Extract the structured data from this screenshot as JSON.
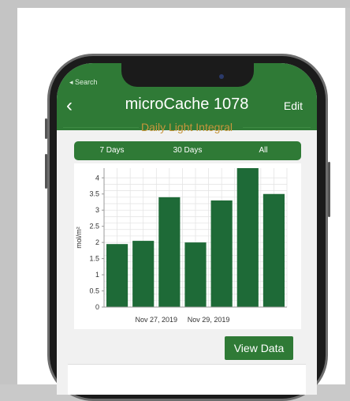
{
  "app": {
    "status_back": "◂ Search",
    "back_glyph": "‹",
    "title": "microCache 1078",
    "edit_label": "Edit",
    "section_title": "Daily Light Integral",
    "tabs": [
      "7 Days",
      "30 Days",
      "All"
    ],
    "view_data_label": "View Data"
  },
  "colors": {
    "brand_green": "#2f7a36",
    "bar_green": "#1e6a37",
    "section_gold": "#c8963c"
  },
  "chart_data": {
    "type": "bar",
    "categories": [
      "1",
      "2",
      "3",
      "4",
      "5",
      "6",
      "7"
    ],
    "values": [
      1.95,
      2.05,
      3.4,
      2.0,
      3.3,
      4.3,
      3.5
    ],
    "ylabel": "mol/m²",
    "ylim": [
      0,
      4.3
    ],
    "yticks": [
      "0",
      "0.5",
      "1",
      "1.5",
      "2",
      "2.5",
      "3",
      "3.5",
      "4"
    ],
    "xticklabels": [
      "Nov 27, 2019",
      "Nov 29, 2019"
    ],
    "grid": true
  }
}
